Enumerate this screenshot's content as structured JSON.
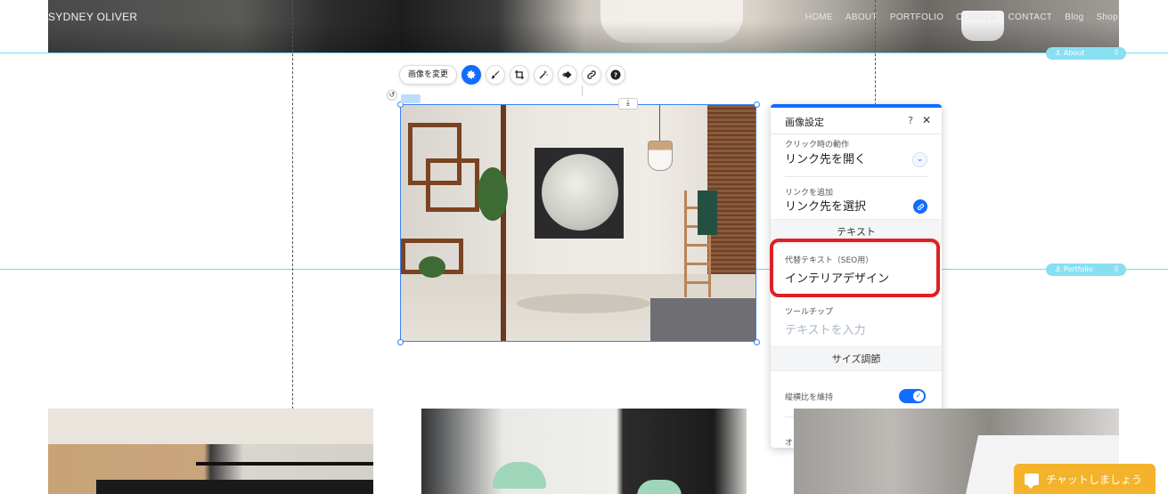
{
  "site": {
    "name": "SYDNEY OLIVER",
    "nav": [
      "HOME",
      "ABOUT",
      "PORTFOLIO",
      "CLIENTS",
      "CONTACT",
      "Blog",
      "Shop"
    ]
  },
  "anchors": {
    "about": "About",
    "portfolio": "Portfolio"
  },
  "toolbar": {
    "change_image": "画像を変更",
    "icons": [
      "gear-icon",
      "paint-brush-icon",
      "crop-icon",
      "magic-wand-icon",
      "animation-icon",
      "link-icon",
      "help-icon"
    ]
  },
  "panel": {
    "title": "画像設定",
    "help": "?",
    "close": "✕",
    "click_action_label": "クリック時の動作",
    "click_action_value": "リンク先を開く",
    "add_link_label": "リンクを追加",
    "add_link_value": "リンク先を選択",
    "section_text": "テキスト",
    "alt_text_label": "代替テキスト（SEO用）",
    "alt_text_value": "インテリアデザイン",
    "tooltip_label": "ツールチップ",
    "tooltip_placeholder": "テキストを入力",
    "section_size": "サイズ調節",
    "keep_ratio_label": "縦横比を維持",
    "keep_ratio_on": true,
    "autofill_label": "オートフィル",
    "autofill_on": false
  },
  "chat": {
    "label": "チャットしましょう"
  },
  "colors": {
    "accent": "#116dff",
    "highlight": "#e02020",
    "guide": "#6fd8ef",
    "chat": "#f3b32a"
  }
}
